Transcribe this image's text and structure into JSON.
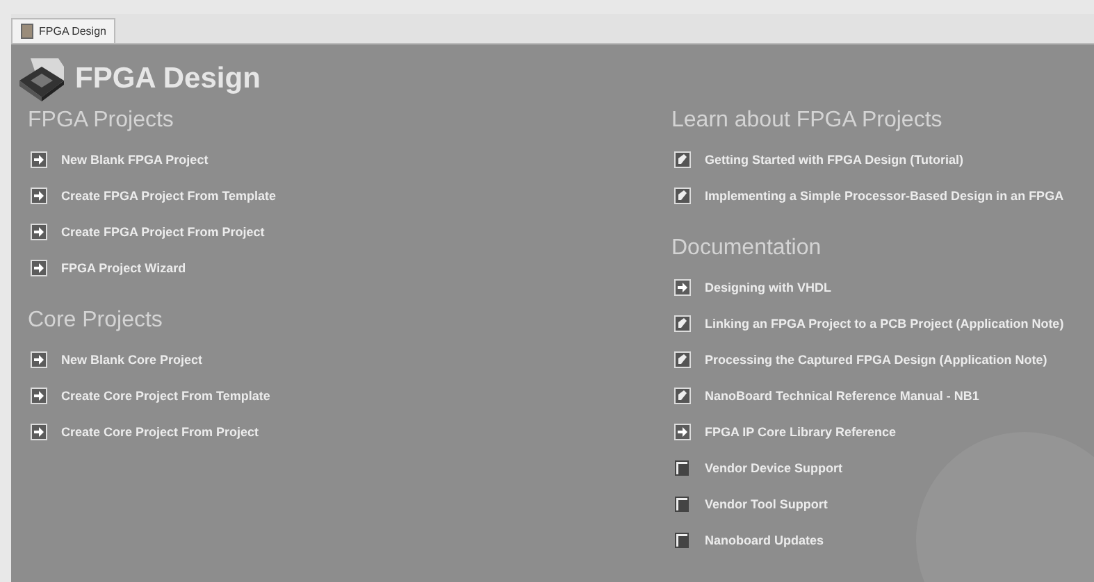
{
  "tab": {
    "title": "FPGA Design"
  },
  "header": {
    "title": "FPGA Design"
  },
  "columns": [
    {
      "sections": [
        {
          "title": "FPGA Projects",
          "items": [
            {
              "label": "New Blank FPGA Project",
              "kind": "action"
            },
            {
              "label": "Create FPGA Project From Template",
              "kind": "action"
            },
            {
              "label": "Create FPGA Project From Project",
              "kind": "action"
            },
            {
              "label": "FPGA Project Wizard",
              "kind": "action"
            }
          ]
        },
        {
          "title": "Core Projects",
          "items": [
            {
              "label": "New Blank Core Project",
              "kind": "action"
            },
            {
              "label": "Create Core Project From Template",
              "kind": "action"
            },
            {
              "label": "Create Core Project From Project",
              "kind": "action"
            }
          ]
        }
      ]
    },
    {
      "sections": [
        {
          "title": "Learn about FPGA Projects",
          "items": [
            {
              "label": "Getting Started with FPGA Design (Tutorial)",
              "kind": "document"
            },
            {
              "label": "Implementing a Simple Processor-Based Design in an FPGA",
              "kind": "document"
            }
          ]
        },
        {
          "title": "Documentation",
          "items": [
            {
              "label": "Designing with VHDL",
              "kind": "action"
            },
            {
              "label": "Linking an FPGA Project to a PCB Project (Application Note)",
              "kind": "document"
            },
            {
              "label": "Processing the Captured FPGA Design (Application Note)",
              "kind": "document"
            },
            {
              "label": "NanoBoard Technical Reference Manual - NB1",
              "kind": "document"
            },
            {
              "label": "FPGA IP Core Library Reference",
              "kind": "action"
            },
            {
              "label": "Vendor Device Support",
              "kind": "web"
            },
            {
              "label": "Vendor Tool Support",
              "kind": "web"
            },
            {
              "label": "Nanoboard Updates",
              "kind": "web"
            }
          ]
        }
      ]
    }
  ]
}
